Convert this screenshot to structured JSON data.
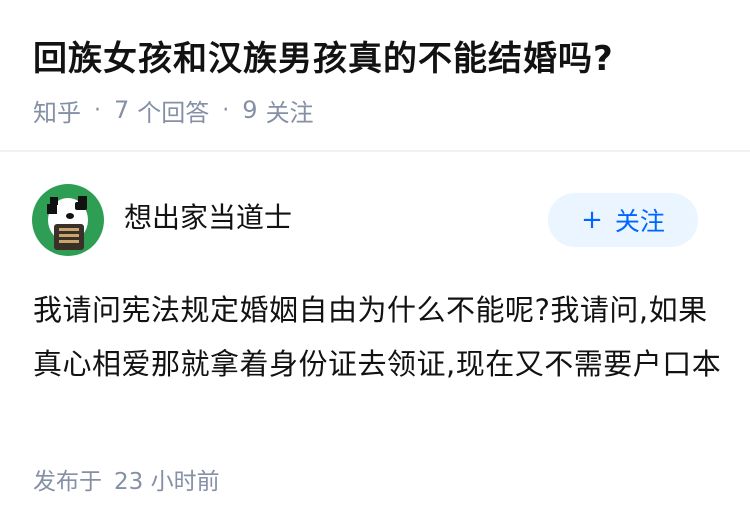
{
  "question": {
    "title": "回族女孩和汉族男孩真的不能结婚吗?",
    "source": "知乎",
    "separator": "·",
    "answers_count": "7",
    "answers_label": "个回答",
    "followers_count": "9",
    "followers_label": "关注"
  },
  "answer": {
    "author": "想出家当道士",
    "follow_button": {
      "icon": "+",
      "label": "关注"
    },
    "content": "我请问宪法规定婚姻自由为什么不能呢?我请问,如果真心相爱那就拿着身份证去领证,现在又不需要户口本",
    "posted_label": "发布于",
    "posted_time": "23 小时前"
  },
  "colors": {
    "accent": "#0066ff",
    "button_bg": "#ebf5ff",
    "meta_text": "#8590a6",
    "avatar_bg": "#2e9e55"
  }
}
